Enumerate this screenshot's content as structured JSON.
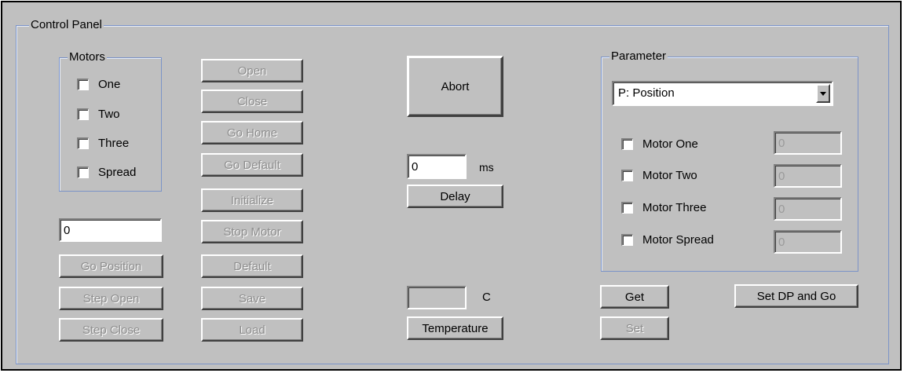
{
  "panel": {
    "title": "Control Panel"
  },
  "motors": {
    "title": "Motors",
    "items": [
      {
        "label": "One",
        "checked": false
      },
      {
        "label": "Two",
        "checked": false
      },
      {
        "label": "Three",
        "checked": false
      },
      {
        "label": "Spread",
        "checked": false
      }
    ]
  },
  "position": {
    "value": "0",
    "go_position": "Go Position",
    "step_open": "Step Open",
    "step_close": "Step Close"
  },
  "actions": {
    "open": "Open",
    "close": "Close",
    "go_home": "Go Home",
    "go_default": "Go Default",
    "initialize": "Initialize",
    "stop_motor": "Stop Motor",
    "default": "Default",
    "save": "Save",
    "load": "Load"
  },
  "abort": {
    "label": "Abort"
  },
  "delay": {
    "value": "0",
    "unit": "ms",
    "button": "Delay"
  },
  "temperature": {
    "value": "",
    "unit": "C",
    "button": "Temperature"
  },
  "parameter": {
    "title": "Parameter",
    "selected": "P: Position",
    "motors": [
      {
        "label": "Motor One",
        "value": "0",
        "checked": false
      },
      {
        "label": "Motor Two",
        "value": "0",
        "checked": false
      },
      {
        "label": "Motor Three",
        "value": "0",
        "checked": false
      },
      {
        "label": "Motor Spread",
        "value": "0",
        "checked": false
      }
    ],
    "get": "Get",
    "set": "Set",
    "set_dp_go": "Set DP and Go"
  },
  "colors": {
    "dialog_bg": "#c0c0c0",
    "group_border": "#7b93c7",
    "disabled_text": "#8e8e8e"
  }
}
